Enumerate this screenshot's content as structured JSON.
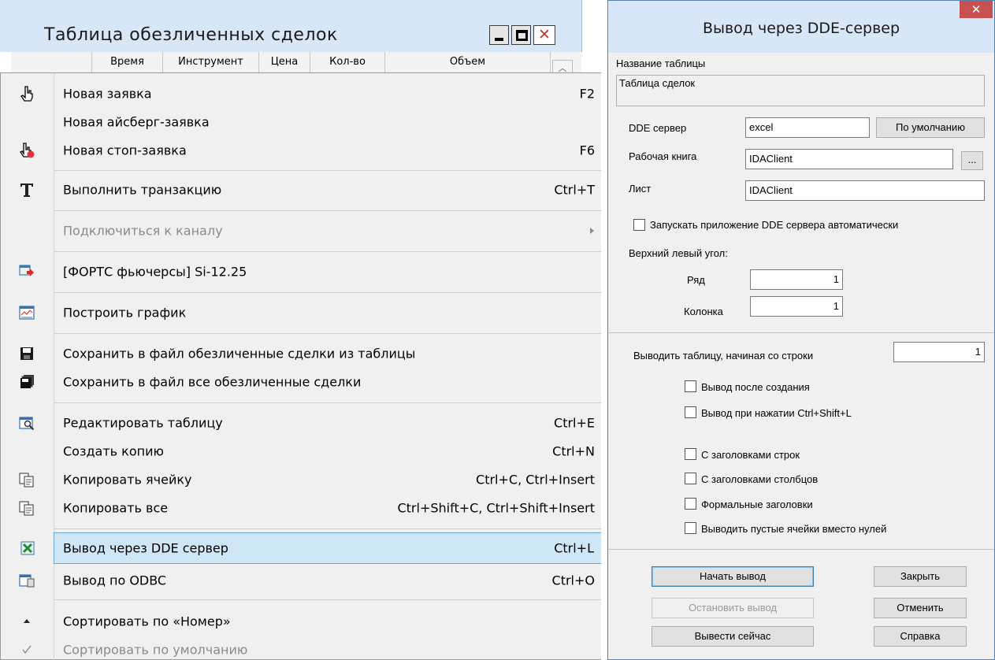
{
  "table_window": {
    "title": "Таблица обезличенных сделок",
    "columns": [
      "Время",
      "Инструмент",
      "Цена",
      "Кол-во",
      "Объем"
    ]
  },
  "menu": {
    "items": [
      {
        "label": "Новая заявка",
        "mnemonic": "Н",
        "shortcut": "F2",
        "icon": "hand-pointer-icon"
      },
      {
        "label": "Новая айсберг-заявка",
        "shortcut": ""
      },
      {
        "label": "Новая стоп-заявка",
        "shortcut": "F6",
        "icon": "hand-stop-icon"
      },
      {
        "label": "Выполнить транзакцию",
        "shortcut": "Ctrl+T",
        "icon": "transaction-t-icon"
      },
      {
        "label": "Подключиться к каналу",
        "shortcut": "",
        "disabled": true
      },
      {
        "label": "[ФОРТС фьючерсы] Si-12.25",
        "shortcut": "",
        "icon": "instrument-icon"
      },
      {
        "label": "Построить график",
        "shortcut": "",
        "icon": "chart-icon"
      },
      {
        "label": "Сохранить в файл обезличенные сделки из таблицы",
        "shortcut": "",
        "icon": "floppy-icon"
      },
      {
        "label": "Сохранить в файл все обезличенные сделки",
        "shortcut": "",
        "icon": "floppy-multi-icon"
      },
      {
        "label": "Редактировать таблицу",
        "shortcut": "Ctrl+E",
        "icon": "edit-table-icon"
      },
      {
        "label": "Создать копию",
        "shortcut": "Ctrl+N"
      },
      {
        "label": "Копировать ячейку",
        "shortcut": "Ctrl+C, Ctrl+Insert",
        "icon": "copy-icon"
      },
      {
        "label": "Копировать все",
        "shortcut": "Ctrl+Shift+C, Ctrl+Shift+Insert",
        "icon": "copy-icon"
      },
      {
        "label": "Вывод через DDE сервер",
        "shortcut": "Ctrl+L",
        "icon": "excel-dde-icon"
      },
      {
        "label": "Вывод по ODBC",
        "shortcut": "Ctrl+O",
        "icon": "odbc-icon"
      },
      {
        "label": "Сортировать по «Номер»",
        "shortcut": "",
        "icon": "sort-up-icon"
      },
      {
        "label": "Сортировать по умолчанию",
        "shortcut": "",
        "icon": "check-icon",
        "disabled": true
      }
    ]
  },
  "dialog": {
    "title": "Вывод через DDE-сервер",
    "table_name_label": "Название таблицы",
    "table_name_value": "Таблица сделок",
    "dde_server_label": "DDE сервер",
    "dde_server_value": "excel",
    "default_button": "По умолчанию",
    "workbook_label": "Рабочая книга",
    "workbook_value": "IDAClient",
    "browse_button": "...",
    "sheet_label": "Лист",
    "sheet_value": "IDAClient",
    "autostart_label": "Запускать приложение DDE сервера автоматически",
    "top_left_label": "Верхний левый угол:",
    "row_label": "Ряд",
    "row_value": "1",
    "col_label": "Колонка",
    "col_value": "1",
    "start_row_label": "Выводить таблицу,  начиная со строки",
    "start_row_value": "1",
    "checkboxes": [
      "Вывод после создания",
      "Вывод при нажатии Ctrl+Shift+L",
      "С заголовками строк",
      "С заголовками столбцов",
      "Формальные заголовки",
      "Выводить пустые ячейки вместо нулей"
    ],
    "buttons": {
      "start": "Начать вывод",
      "stop": "Остановить вывод",
      "now": "Вывести сейчас",
      "close": "Закрыть",
      "cancel": "Отменить",
      "help": "Справка"
    }
  },
  "colors": {
    "highlight": "#cfe6f7",
    "titlebar": "#d7e7f7",
    "close_red": "#c75050"
  }
}
